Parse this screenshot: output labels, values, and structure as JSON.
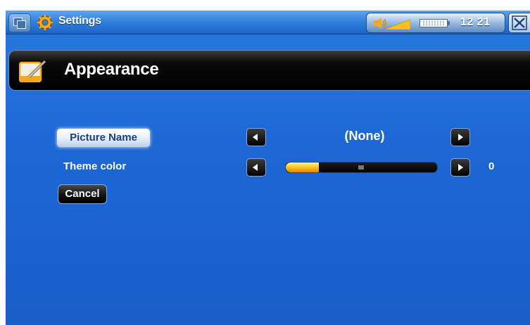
{
  "app": {
    "title": "Settings",
    "icon": "gear-icon"
  },
  "status": {
    "time": "12 21",
    "volume_icon": "speaker-icon",
    "battery_icon": "battery-icon"
  },
  "header": {
    "title": "Appearance",
    "icon": "paint-brush-icon"
  },
  "picture": {
    "button_label": "Picture Name",
    "value": "(None)"
  },
  "theme": {
    "label": "Theme color",
    "value": "0",
    "slider_level": 0.22
  },
  "cancel": {
    "label": "Cancel"
  },
  "colors": {
    "background": "#1d68d6",
    "accent": "#f8c21a",
    "header": "#000000"
  }
}
